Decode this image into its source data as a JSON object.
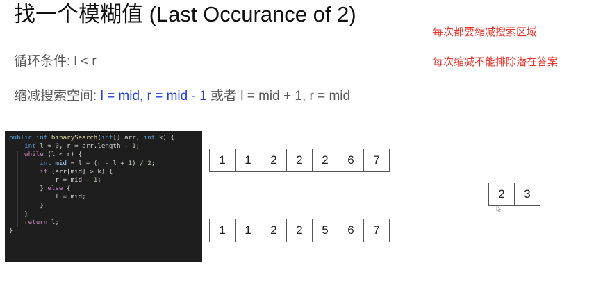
{
  "title": "找一个模糊值 (Last Occurance of 2)",
  "loop_condition": "循环条件: l < r",
  "shrink": {
    "prefix": "缩减搜索空间: ",
    "option1": "l = mid, r = mid - 1",
    "or": " 或者 ",
    "option2": "l = mid + 1, r = mid"
  },
  "notes": {
    "note1": "每次都要缩减搜索区域",
    "note2": "每次缩减不能排除潜在答案"
  },
  "code": {
    "lines": [
      [
        {
          "t": "public",
          "c": "#569cd6"
        },
        {
          "t": " "
        },
        {
          "t": "int",
          "c": "#569cd6"
        },
        {
          "t": " "
        },
        {
          "t": "binarySearch",
          "c": "#dcdcaa"
        },
        {
          "t": "("
        },
        {
          "t": "int",
          "c": "#569cd6"
        },
        {
          "t": "[] arr, "
        },
        {
          "t": "int",
          "c": "#569cd6"
        },
        {
          "t": " k) {"
        }
      ],
      [
        {
          "t": "    "
        },
        {
          "t": "int",
          "c": "#569cd6"
        },
        {
          "t": " l = "
        },
        {
          "t": "0",
          "c": "#b5cea8"
        },
        {
          "t": ", r = arr.length - "
        },
        {
          "t": "1",
          "c": "#b5cea8"
        },
        {
          "t": ";"
        }
      ],
      [
        {
          "t": "    "
        },
        {
          "t": "while",
          "c": "#c586c0"
        },
        {
          "t": " (l < r) {"
        }
      ],
      [
        {
          "t": "        "
        },
        {
          "t": "int",
          "c": "#569cd6"
        },
        {
          "t": " "
        },
        {
          "t": "mid",
          "c": "#9cdcfe"
        },
        {
          "t": " = l + (r - l + "
        },
        {
          "t": "1",
          "c": "#b5cea8"
        },
        {
          "t": ") / "
        },
        {
          "t": "2",
          "c": "#b5cea8"
        },
        {
          "t": ";"
        }
      ],
      [
        {
          "t": "        "
        },
        {
          "t": "if",
          "c": "#c586c0"
        },
        {
          "t": " (arr[mid] > k) {"
        }
      ],
      [
        {
          "t": "            r = mid - "
        },
        {
          "t": "1",
          "c": "#b5cea8"
        },
        {
          "t": ";"
        }
      ],
      [
        {
          "t": "        } "
        },
        {
          "t": "else",
          "c": "#c586c0"
        },
        {
          "t": " {"
        }
      ],
      [
        {
          "t": "            l = mid;"
        }
      ],
      [
        {
          "t": "        }"
        }
      ],
      [
        {
          "t": "    }"
        }
      ],
      [
        {
          "t": "    "
        },
        {
          "t": "return",
          "c": "#c586c0"
        },
        {
          "t": " l;"
        }
      ],
      [
        {
          "t": "}"
        }
      ]
    ]
  },
  "array1": [
    "1",
    "1",
    "2",
    "2",
    "2",
    "6",
    "7"
  ],
  "array2": [
    "1",
    "1",
    "2",
    "2",
    "5",
    "6",
    "7"
  ],
  "array3": [
    "2",
    "3"
  ],
  "colors": {
    "title": "#111111",
    "body_text": "#595959",
    "highlight_blue": "#1f3fe0",
    "note_red": "#e8332a",
    "code_background": "#1e1e1e"
  }
}
